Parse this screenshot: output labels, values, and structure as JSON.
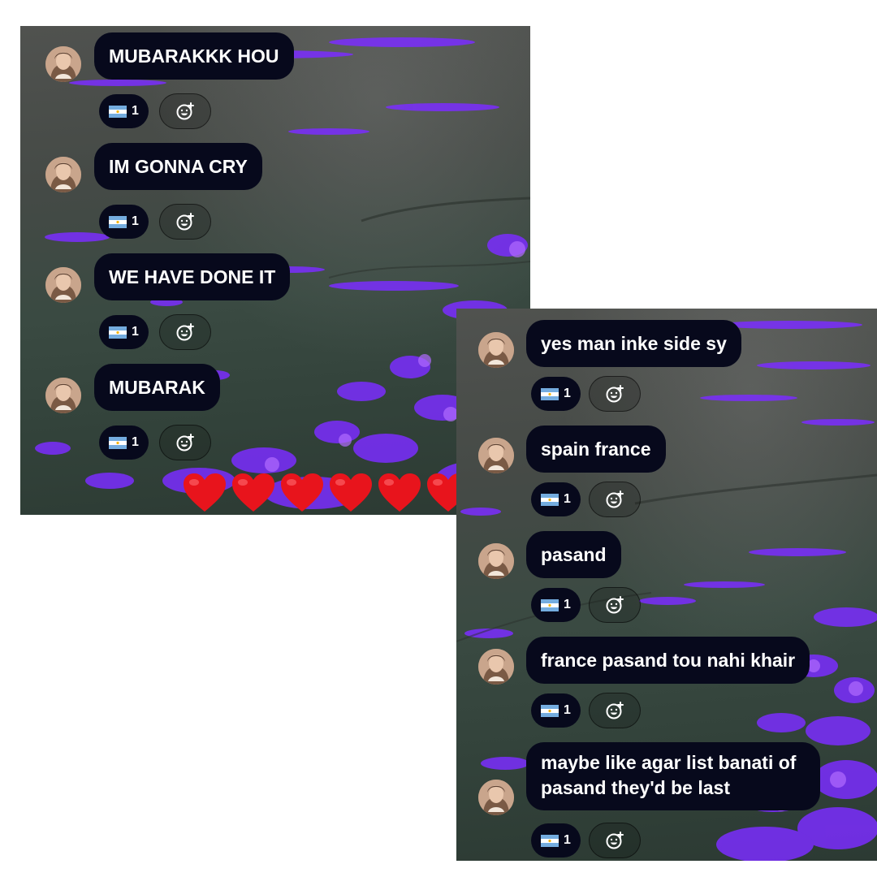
{
  "colors": {
    "bubble": "#07091c",
    "text": "#ffffff",
    "heart": "#e8141c",
    "flower": "#7b2dff"
  },
  "icons": {
    "reaction_flag": "argentina-flag-icon",
    "add_reaction": "add-reaction-smiley-icon",
    "heart": "red-heart-icon"
  },
  "left_screenshot": {
    "messages": [
      {
        "text": "MUBARAKKK HOU",
        "reaction_count": "1"
      },
      {
        "text": "IM GONNA CRY",
        "reaction_count": "1"
      },
      {
        "text": "WE HAVE DONE IT",
        "reaction_count": "1"
      },
      {
        "text": "MUBARAK",
        "reaction_count": "1"
      }
    ],
    "floating_hearts": 6
  },
  "right_screenshot": {
    "messages": [
      {
        "text": "yes man inke side sy",
        "reaction_count": "1"
      },
      {
        "text": "spain france",
        "reaction_count": "1"
      },
      {
        "text": "pasand",
        "reaction_count": "1"
      },
      {
        "text": "france pasand tou nahi khair",
        "reaction_count": "1"
      },
      {
        "text": "maybe like agar list banati of pasand they'd be last",
        "reaction_count": "1"
      }
    ]
  }
}
